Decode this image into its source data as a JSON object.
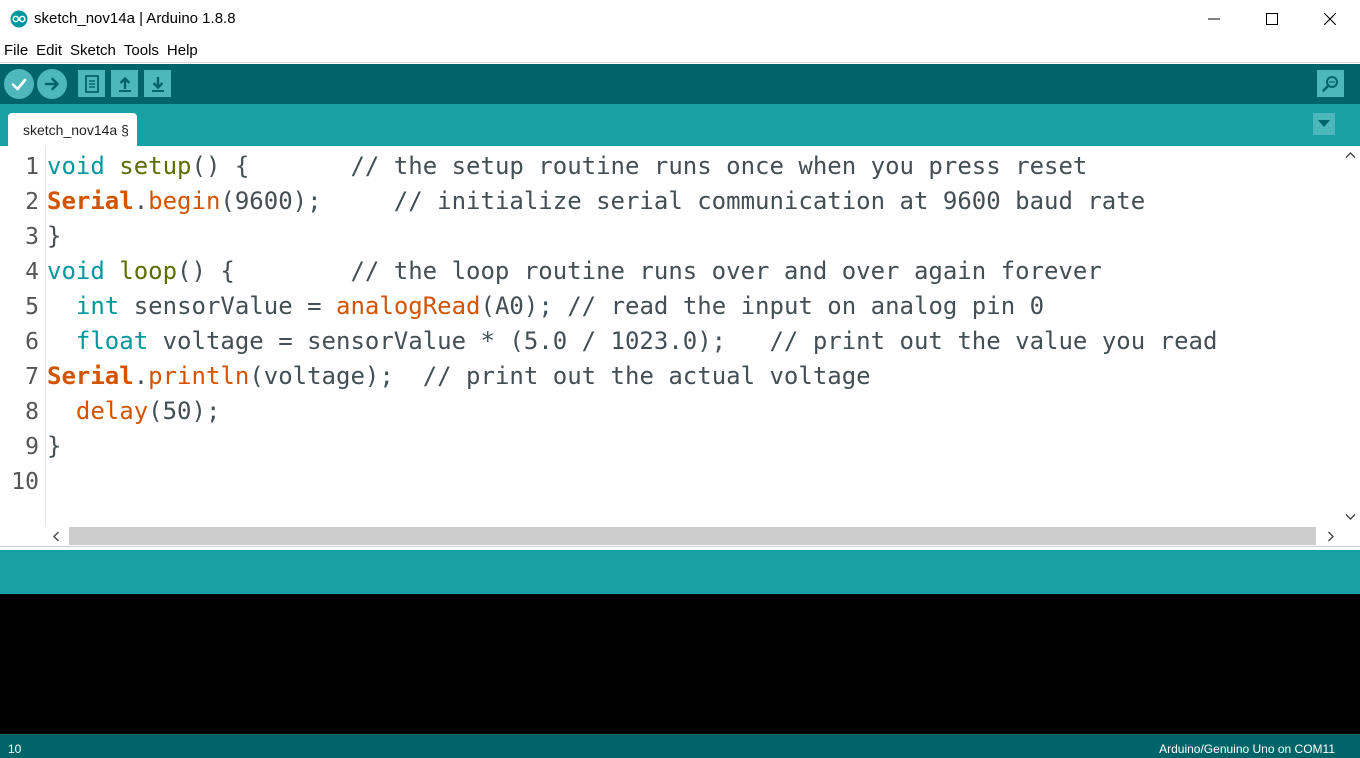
{
  "window": {
    "title": "sketch_nov14a | Arduino 1.8.8",
    "controls": [
      "minimize",
      "maximize",
      "close"
    ]
  },
  "menubar": {
    "items": [
      "File",
      "Edit",
      "Sketch",
      "Tools",
      "Help"
    ]
  },
  "toolbar": {
    "buttons": [
      "verify-icon",
      "upload-icon",
      "new-icon",
      "open-icon",
      "save-icon"
    ],
    "right_button": "serial-monitor-icon"
  },
  "tabs": [
    {
      "label": "sketch_nov14a §",
      "active": true
    }
  ],
  "editor": {
    "line_numbers": [
      "1",
      "2",
      "3",
      "4",
      "5",
      "6",
      "7",
      "8",
      "9",
      "10"
    ],
    "lines": [
      [
        {
          "t": "void",
          "c": "kw"
        },
        {
          "t": " ",
          "c": ""
        },
        {
          "t": "setup",
          "c": "fn"
        },
        {
          "t": "() {       ",
          "c": ""
        },
        {
          "t": "// the setup routine runs once when you press reset",
          "c": "cm"
        }
      ],
      [
        {
          "t": "Serial",
          "c": "cls"
        },
        {
          "t": ".",
          "c": ""
        },
        {
          "t": "begin",
          "c": "lib"
        },
        {
          "t": "(9600);     ",
          "c": ""
        },
        {
          "t": "// initialize serial communication at 9600 baud rate",
          "c": "cm"
        }
      ],
      [
        {
          "t": "}",
          "c": ""
        }
      ],
      [
        {
          "t": "void",
          "c": "kw"
        },
        {
          "t": " ",
          "c": ""
        },
        {
          "t": "loop",
          "c": "fn"
        },
        {
          "t": "() {        ",
          "c": ""
        },
        {
          "t": "// the loop routine runs over and over again forever",
          "c": "cm"
        }
      ],
      [
        {
          "t": "  ",
          "c": ""
        },
        {
          "t": "int",
          "c": "kw"
        },
        {
          "t": " sensorValue = ",
          "c": ""
        },
        {
          "t": "analogRead",
          "c": "lib"
        },
        {
          "t": "(A0); ",
          "c": ""
        },
        {
          "t": "// read the input on analog pin 0",
          "c": "cm"
        }
      ],
      [
        {
          "t": "  ",
          "c": ""
        },
        {
          "t": "float",
          "c": "kw"
        },
        {
          "t": " voltage = sensorValue * (5.0 / 1023.0);   ",
          "c": ""
        },
        {
          "t": "// print out the value you read",
          "c": "cm"
        }
      ],
      [
        {
          "t": "Serial",
          "c": "cls"
        },
        {
          "t": ".",
          "c": ""
        },
        {
          "t": "println",
          "c": "lib"
        },
        {
          "t": "(voltage);  ",
          "c": ""
        },
        {
          "t": "// print out the actual voltage",
          "c": "cm"
        }
      ],
      [
        {
          "t": "  ",
          "c": ""
        },
        {
          "t": "delay",
          "c": "lib"
        },
        {
          "t": "(50);",
          "c": ""
        }
      ],
      [
        {
          "t": "}",
          "c": ""
        }
      ],
      [
        {
          "t": "",
          "c": ""
        }
      ]
    ]
  },
  "status": {
    "line": "10",
    "board": "Arduino/Genuino Uno on COM11"
  },
  "colors": {
    "toolbar_bg": "#006468",
    "tabstrip_bg": "#17a1a5",
    "button_bg": "#4db7bb",
    "keyword": "#00979c",
    "function": "#5e6d03",
    "library": "#d35400",
    "console_bg": "#000000"
  }
}
